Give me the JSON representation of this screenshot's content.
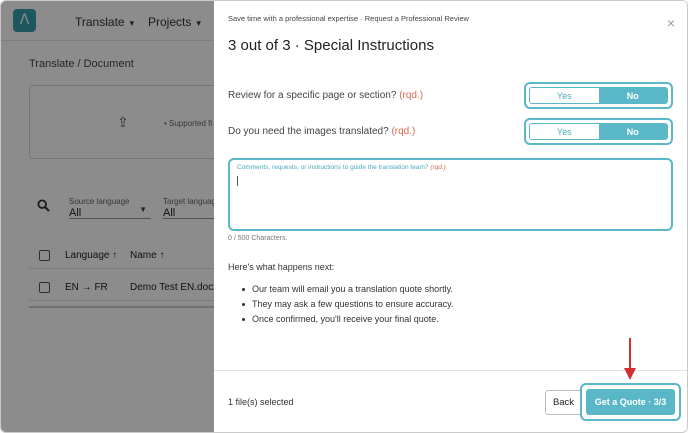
{
  "app": {
    "nav": [
      {
        "label": "Translate"
      },
      {
        "label": "Projects"
      }
    ],
    "breadcrumb": "Translate  /  Document",
    "upload_hint": "•  Supported fi",
    "filters": {
      "source": {
        "label": "Source language",
        "value": "All"
      },
      "target": {
        "label": "Target languag",
        "value": "All"
      }
    },
    "table": {
      "headers": [
        "Language ↑",
        "Name ↑"
      ],
      "row": {
        "language": "EN  →  FR",
        "name": "Demo Test EN.docx"
      }
    }
  },
  "modal": {
    "subtitle": "Save time with a professional expertise · Request a Professional Review",
    "close_glyph": "×",
    "title": "3 out of 3 · Special Instructions",
    "questions": [
      {
        "text": "Review for a specific page or section?",
        "required": "(rqd.)",
        "yes": "Yes",
        "no": "No",
        "selected": "No"
      },
      {
        "text": "Do you need the images translated?",
        "required": "(rqd.)",
        "yes": "Yes",
        "no": "No",
        "selected": "No"
      }
    ],
    "comments": {
      "placeholder": "Comments, requests, or instructions to guide the translation team?",
      "required": "(rqd.)",
      "value": "",
      "char_count": "0 / 500 Characters."
    },
    "next_heading": "Here's what happens next:",
    "next_steps": [
      "Our team will email you a translation quote shortly.",
      "They may ask a few questions to ensure accuracy.",
      "Once confirmed, you'll receive your final quote."
    ],
    "footer": {
      "selected": "1 file(s) selected",
      "back": "Back",
      "quote": "Get a Quote · 3/3"
    }
  },
  "colors": {
    "accent": "#5ab7c7",
    "required": "#d9694f",
    "annotation_arrow": "#d32f2f"
  }
}
